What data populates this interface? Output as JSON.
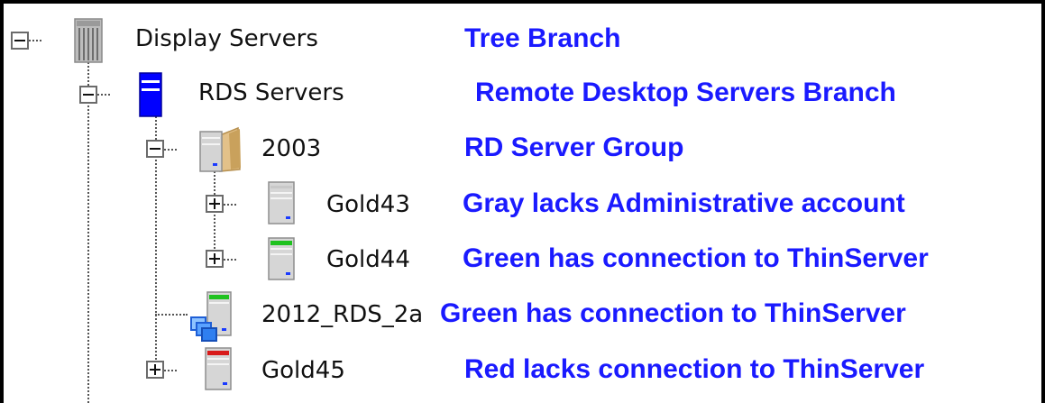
{
  "tree": {
    "nodes": [
      {
        "label": "Display Servers",
        "toggle": "collapse",
        "icon": "server-rack-gray-icon"
      },
      {
        "label": "RDS Servers",
        "toggle": "collapse",
        "icon": "server-blue-icon"
      },
      {
        "label": "2003",
        "toggle": "collapse",
        "icon": "server-folder-group-icon"
      },
      {
        "label": "Gold43",
        "toggle": "expand",
        "icon": "server-gray-icon"
      },
      {
        "label": "Gold44",
        "toggle": "expand",
        "icon": "server-green-icon"
      },
      {
        "label": "2012_RDS_2a",
        "toggle": "none",
        "icon": "server-green-remote-icon"
      },
      {
        "label": "Gold45",
        "toggle": "expand",
        "icon": "server-red-icon"
      }
    ]
  },
  "descriptions": [
    "Tree Branch",
    "Remote Desktop Servers Branch",
    "RD Server Group",
    "Gray lacks Administrative account",
    "Green has connection to ThinServer",
    "Green has connection to ThinServer",
    "Red lacks connection to ThinServer"
  ],
  "colors": {
    "description_text": "#1a1aff",
    "status_gray": "#c8c8c8",
    "status_green": "#1fc21f",
    "status_red": "#d81b1b",
    "rds_blue": "#0000ff"
  }
}
